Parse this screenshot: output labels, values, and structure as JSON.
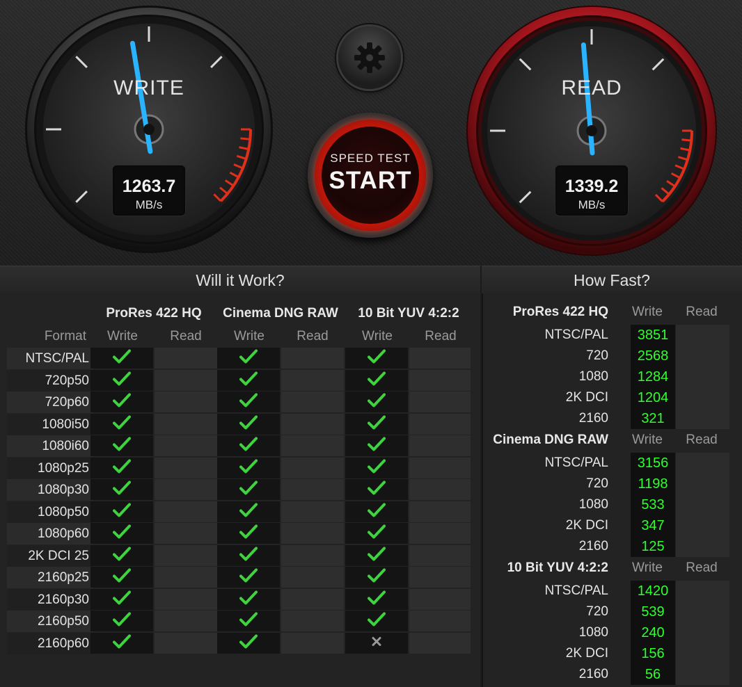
{
  "write_gauge": {
    "label": "WRITE",
    "value": "1263.7",
    "unit": "MB/s",
    "needle_fraction": 0.46
  },
  "read_gauge": {
    "label": "READ",
    "value": "1339.2",
    "unit": "MB/s",
    "needle_fraction": 0.48
  },
  "start_button": {
    "top_label": "SPEED TEST",
    "main_label": "START"
  },
  "settings_icon": "gear-icon",
  "will_it_work": {
    "title": "Will it Work?",
    "format_header": "Format",
    "groups": [
      {
        "name": "ProRes 422 HQ",
        "write": "Write",
        "read": "Read"
      },
      {
        "name": "Cinema DNG RAW",
        "write": "Write",
        "read": "Read"
      },
      {
        "name": "10 Bit YUV 4:2:2",
        "write": "Write",
        "read": "Read"
      }
    ],
    "rows": [
      {
        "format": "NTSC/PAL",
        "status": [
          true,
          true,
          true
        ]
      },
      {
        "format": "720p50",
        "status": [
          true,
          true,
          true
        ]
      },
      {
        "format": "720p60",
        "status": [
          true,
          true,
          true
        ]
      },
      {
        "format": "1080i50",
        "status": [
          true,
          true,
          true
        ]
      },
      {
        "format": "1080i60",
        "status": [
          true,
          true,
          true
        ]
      },
      {
        "format": "1080p25",
        "status": [
          true,
          true,
          true
        ]
      },
      {
        "format": "1080p30",
        "status": [
          true,
          true,
          true
        ]
      },
      {
        "format": "1080p50",
        "status": [
          true,
          true,
          true
        ]
      },
      {
        "format": "1080p60",
        "status": [
          true,
          true,
          true
        ]
      },
      {
        "format": "2K DCI 25",
        "status": [
          true,
          true,
          true
        ]
      },
      {
        "format": "2160p25",
        "status": [
          true,
          true,
          true
        ]
      },
      {
        "format": "2160p30",
        "status": [
          true,
          true,
          true
        ]
      },
      {
        "format": "2160p50",
        "status": [
          true,
          true,
          true
        ]
      },
      {
        "format": "2160p60",
        "status": [
          true,
          true,
          false
        ]
      }
    ]
  },
  "how_fast": {
    "title": "How Fast?",
    "sections": [
      {
        "name": "ProRes 422 HQ",
        "write": "Write",
        "read": "Read",
        "rows": [
          {
            "label": "NTSC/PAL",
            "write": "3851"
          },
          {
            "label": "720",
            "write": "2568"
          },
          {
            "label": "1080",
            "write": "1284"
          },
          {
            "label": "2K DCI",
            "write": "1204"
          },
          {
            "label": "2160",
            "write": "321"
          }
        ]
      },
      {
        "name": "Cinema DNG RAW",
        "write": "Write",
        "read": "Read",
        "rows": [
          {
            "label": "NTSC/PAL",
            "write": "3156"
          },
          {
            "label": "720",
            "write": "1198"
          },
          {
            "label": "1080",
            "write": "533"
          },
          {
            "label": "2K DCI",
            "write": "347"
          },
          {
            "label": "2160",
            "write": "125"
          }
        ]
      },
      {
        "name": "10 Bit YUV 4:2:2",
        "write": "Write",
        "read": "Read",
        "rows": [
          {
            "label": "NTSC/PAL",
            "write": "1420"
          },
          {
            "label": "720",
            "write": "539"
          },
          {
            "label": "1080",
            "write": "240"
          },
          {
            "label": "2K DCI",
            "write": "156"
          },
          {
            "label": "2160",
            "write": "56"
          }
        ]
      }
    ]
  },
  "colors": {
    "needle": "#2ab4ff",
    "check": "#3fd43f",
    "value_green": "#2fff2f",
    "read_ring": "#d0202a",
    "accent_red": "#e0301c"
  }
}
